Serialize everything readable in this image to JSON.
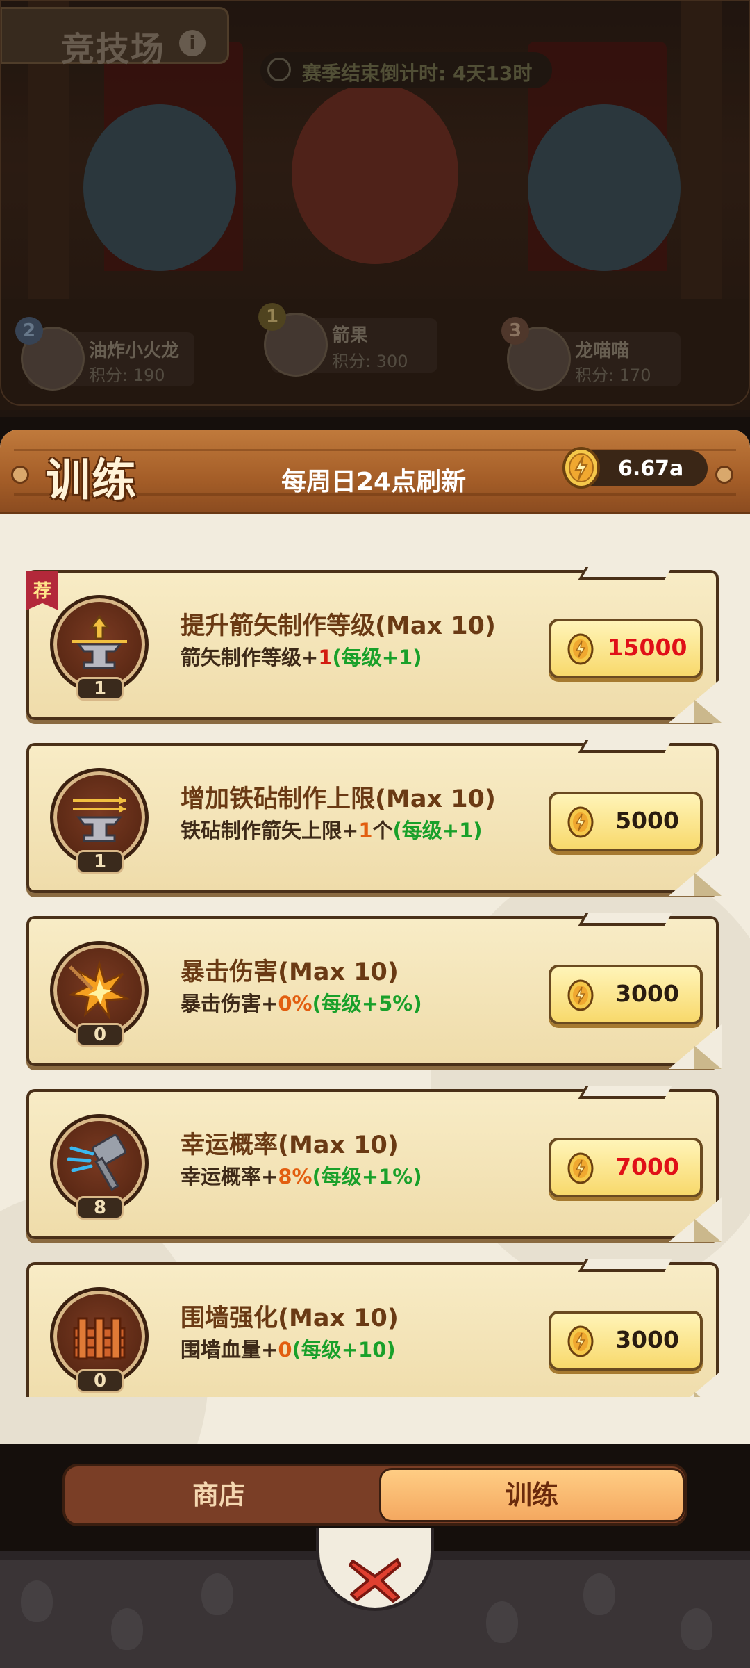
{
  "arena": {
    "title": "竞技场",
    "info_icon": "info-icon",
    "season_countdown": "赛季结束倒计时: 4天13时",
    "ranks": [
      {
        "rank": "2",
        "name": "油炸小火龙",
        "score": "积分: 190"
      },
      {
        "rank": "1",
        "name": "箭果",
        "score": "积分: 300"
      },
      {
        "rank": "3",
        "name": "龙喵喵",
        "score": "积分: 170"
      }
    ]
  },
  "panel": {
    "title": "训练",
    "refresh_note": "每周日24点刷新",
    "currency": {
      "icon": "lightning-coin-icon",
      "amount": "6.67a"
    }
  },
  "upgrades": [
    {
      "recommended_tag": "荐",
      "icon": "anvil-arrow-up-icon",
      "level": "1",
      "title": "提升箭矢制作等级(Max 10)",
      "desc_prefix": "箭矢制作等级+",
      "desc_value": "1",
      "desc_unit": "",
      "desc_step": "(每级+1)",
      "price": "15000",
      "price_color": "red"
    },
    {
      "icon": "anvil-arrows-icon",
      "level": "1",
      "title": "增加铁砧制作上限(Max 10)",
      "desc_prefix": "铁砧制作箭矢上限+",
      "desc_value": "1",
      "desc_unit": "个",
      "desc_step": "(每级+1)",
      "price": "5000",
      "price_color": "dark"
    },
    {
      "icon": "critical-hit-icon",
      "level": "0",
      "title": "暴击伤害(Max 10)",
      "desc_prefix": "暴击伤害+",
      "desc_value": "0%",
      "desc_unit": "",
      "desc_step": "(每级+5%)",
      "price": "3000",
      "price_color": "dark"
    },
    {
      "icon": "lucky-hammer-icon",
      "level": "8",
      "title": "幸运概率(Max 10)",
      "desc_prefix": "幸运概率+",
      "desc_value": "8%",
      "desc_unit": "",
      "desc_step": "(每级+1%)",
      "price": "7000",
      "price_color": "red"
    },
    {
      "icon": "wall-icon",
      "level": "0",
      "title": "围墙强化(Max 10)",
      "desc_prefix": "围墙血量+",
      "desc_value": "0",
      "desc_unit": "",
      "desc_step": "(每级+10)",
      "price": "3000",
      "price_color": "dark"
    }
  ],
  "tabs": {
    "shop": "商店",
    "train": "训练",
    "active": "train"
  },
  "close_icon": "close-icon",
  "colors": {
    "accent_red": "#e01018",
    "accent_green": "#19a02a",
    "accent_orange": "#e25e10",
    "wood": "#a55e28"
  }
}
